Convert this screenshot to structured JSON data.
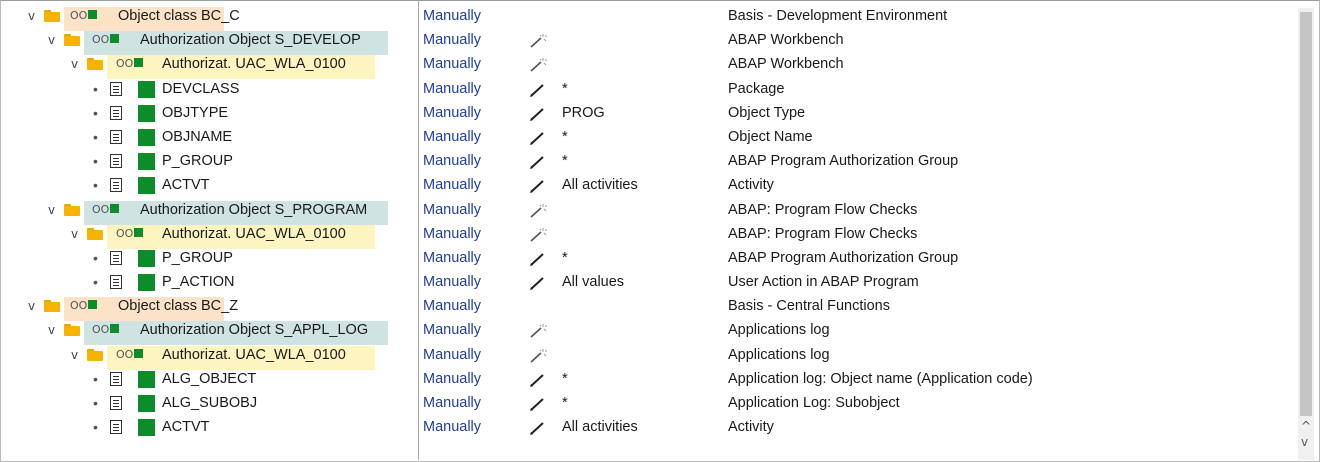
{
  "columns": {
    "maintained_by": "Manually"
  },
  "icons": {
    "expanded": "chevron-down-icon",
    "folder": "folder-icon",
    "document": "document-icon",
    "authorization": "authorization-icon",
    "pencil": "pencil-icon",
    "wand": "magic-wand-icon"
  },
  "colors": {
    "accent_green": "#0d8c2a",
    "class_highlight": "#fce3c8",
    "object_highlight": "#cfe3e2",
    "auth_highlight": "#fdf4c0",
    "link_blue": "#1f3f9e"
  },
  "rows": [
    {
      "type": "class",
      "label": "Object class BC_C",
      "status": "Manually",
      "value": "",
      "description": "Basis - Development Environment"
    },
    {
      "type": "object",
      "label": "Authorization Object S_DEVELOP",
      "status": "Manually",
      "value": "",
      "description": "ABAP Workbench"
    },
    {
      "type": "auth",
      "label": "Authorizat. UAC_WLA_0100",
      "status": "Manually",
      "value": "",
      "description": "ABAP Workbench"
    },
    {
      "type": "field",
      "label": "DEVCLASS",
      "status": "Manually",
      "value": "*",
      "description": "Package"
    },
    {
      "type": "field",
      "label": "OBJTYPE",
      "status": "Manually",
      "value": "PROG",
      "description": "Object Type"
    },
    {
      "type": "field",
      "label": "OBJNAME",
      "status": "Manually",
      "value": "*",
      "description": "Object Name"
    },
    {
      "type": "field",
      "label": "P_GROUP",
      "status": "Manually",
      "value": "*",
      "description": "ABAP Program Authorization Group"
    },
    {
      "type": "field",
      "label": "ACTVT",
      "status": "Manually",
      "value": "All activities",
      "description": "Activity"
    },
    {
      "type": "object",
      "label": "Authorization Object S_PROGRAM",
      "status": "Manually",
      "value": "",
      "description": "ABAP: Program Flow Checks"
    },
    {
      "type": "auth",
      "label": "Authorizat. UAC_WLA_0100",
      "status": "Manually",
      "value": "",
      "description": "ABAP: Program Flow Checks"
    },
    {
      "type": "field",
      "label": "P_GROUP",
      "status": "Manually",
      "value": "*",
      "description": "ABAP Program Authorization Group"
    },
    {
      "type": "field",
      "label": "P_ACTION",
      "status": "Manually",
      "value": "All values",
      "description": "User Action in ABAP Program"
    },
    {
      "type": "class",
      "label": "Object class BC_Z",
      "status": "Manually",
      "value": "",
      "description": "Basis - Central Functions"
    },
    {
      "type": "object",
      "label": "Authorization Object S_APPL_LOG",
      "status": "Manually",
      "value": "",
      "description": "Applications log"
    },
    {
      "type": "auth",
      "label": "Authorizat. UAC_WLA_0100",
      "status": "Manually",
      "value": "",
      "description": "Applications log"
    },
    {
      "type": "field",
      "label": "ALG_OBJECT",
      "status": "Manually",
      "value": "*",
      "description": "Application log: Object name (Application code)"
    },
    {
      "type": "field",
      "label": "ALG_SUBOBJ",
      "status": "Manually",
      "value": "*",
      "description": "Application Log: Subobject"
    },
    {
      "type": "field",
      "label": "ACTVT",
      "status": "Manually",
      "value": "All activities",
      "description": "Activity"
    }
  ]
}
